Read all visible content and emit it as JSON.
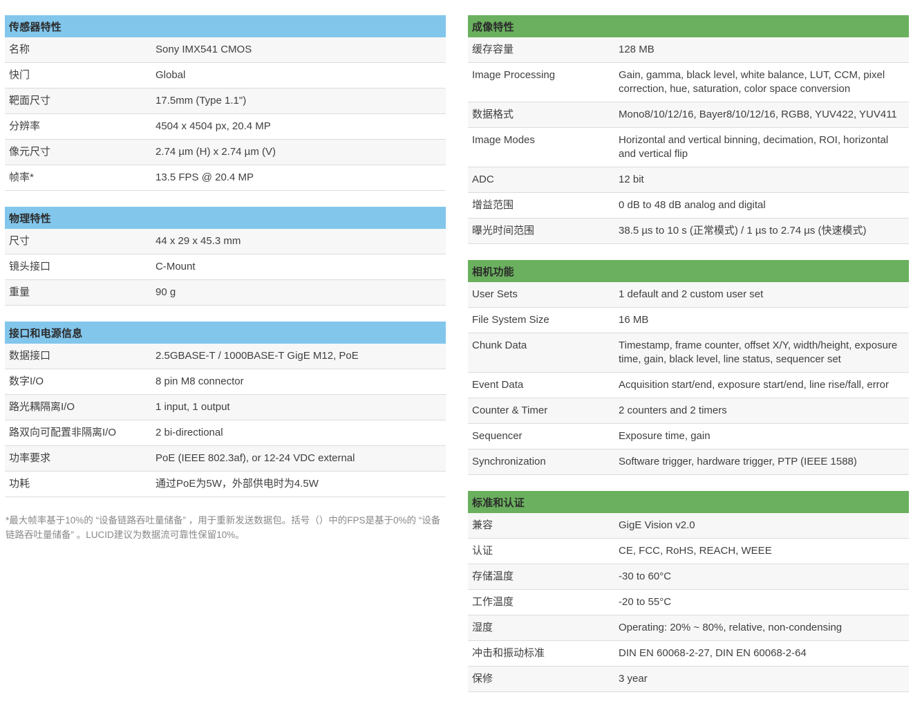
{
  "colors": {
    "blue_header_bg": "#82c6ec",
    "green_header_bg": "#6ab05e",
    "row_alt_bg": "#f7f7f7",
    "row_border": "#dcdcdc",
    "body_text": "#3f3f3f",
    "footnote_text": "#888888"
  },
  "left": {
    "sections": [
      {
        "title": "传感器特性",
        "rows": [
          {
            "label": "名称",
            "value": "Sony IMX541 CMOS"
          },
          {
            "label": "快门",
            "value": "Global"
          },
          {
            "label": "靶面尺寸",
            "value": "17.5mm (Type 1.1\")"
          },
          {
            "label": "分辨率",
            "value": "4504 x 4504 px, 20.4 MP"
          },
          {
            "label": "像元尺寸",
            "value": "2.74 µm (H) x 2.74 µm (V)"
          },
          {
            "label": "帧率*",
            "value": "13.5 FPS @ 20.4 MP"
          }
        ]
      },
      {
        "title": "物理特性",
        "rows": [
          {
            "label": "尺寸",
            "value": "44 x 29 x 45.3 mm"
          },
          {
            "label": "镜头接口",
            "value": "C-Mount"
          },
          {
            "label": "重量",
            "value": "90 g"
          }
        ]
      },
      {
        "title": "接口和电源信息",
        "rows": [
          {
            "label": "数据接口",
            "value": "2.5GBASE-T / 1000BASE-T GigE M12, PoE"
          },
          {
            "label": "数字I/O",
            "value": "8 pin M8 connector"
          },
          {
            "label": "路光耦隔离I/O",
            "value": "1 input, 1 output"
          },
          {
            "label": "路双向可配置非隔离I/O",
            "value": "2 bi-directional"
          },
          {
            "label": "功率要求",
            "value": "PoE (IEEE 802.3af), or 12-24 VDC external"
          },
          {
            "label": "功耗",
            "value": "通过PoE为5W，外部供电时为4.5W"
          }
        ]
      }
    ],
    "footnote": "*最大帧率基于10%的 “设备链路吞吐量储备” ，用于重新发送数据包。括号（）中的FPS是基于0%的 “设备链路吞吐量储备” 。LUCID建议为数据流可靠性保留10%。"
  },
  "right": {
    "sections": [
      {
        "title": "成像特性",
        "rows": [
          {
            "label": "缓存容量",
            "value": "128 MB"
          },
          {
            "label": "Image Processing",
            "value": "Gain, gamma, black level, white balance, LUT, CCM, pixel correction, hue, saturation, color space conversion"
          },
          {
            "label": "数据格式",
            "value": "Mono8/10/12/16, Bayer8/10/12/16, RGB8, YUV422, YUV411"
          },
          {
            "label": "Image Modes",
            "value": "Horizontal and vertical binning, decimation, ROI, horizontal and vertical flip"
          },
          {
            "label": "ADC",
            "value": "12 bit"
          },
          {
            "label": "增益范围",
            "value": "0 dB to 48 dB analog and digital"
          },
          {
            "label": "曝光时间范围",
            "value": "38.5 µs to 10 s (正常模式) / 1 µs to 2.74 µs (快速模式)"
          }
        ]
      },
      {
        "title": "相机功能",
        "rows": [
          {
            "label": "User Sets",
            "value": "1 default and 2 custom user set"
          },
          {
            "label": "File System Size",
            "value": "16 MB"
          },
          {
            "label": "Chunk Data",
            "value": "Timestamp, frame counter, offset X/Y, width/height, exposure time, gain, black level, line status, sequencer set"
          },
          {
            "label": "Event Data",
            "value": "Acquisition start/end, exposure start/end, line rise/fall, error"
          },
          {
            "label": "Counter & Timer",
            "value": "2 counters and 2 timers"
          },
          {
            "label": "Sequencer",
            "value": "Exposure time, gain"
          },
          {
            "label": "Synchronization",
            "value": "Software trigger, hardware trigger, PTP (IEEE 1588)"
          }
        ]
      },
      {
        "title": "标准和认证",
        "rows": [
          {
            "label": "兼容",
            "value": "GigE Vision v2.0"
          },
          {
            "label": "认证",
            "value": "CE, FCC, RoHS, REACH, WEEE"
          },
          {
            "label": "存储温度",
            "value": "-30 to 60°C"
          },
          {
            "label": "工作温度",
            "value": "-20 to 55°C"
          },
          {
            "label": "湿度",
            "value": "Operating: 20% ~ 80%, relative, non-condensing"
          },
          {
            "label": "冲击和振动标准",
            "value": "DIN EN 60068-2-27, DIN EN 60068-2-64"
          },
          {
            "label": "保修",
            "value": "3 year"
          }
        ]
      }
    ]
  }
}
